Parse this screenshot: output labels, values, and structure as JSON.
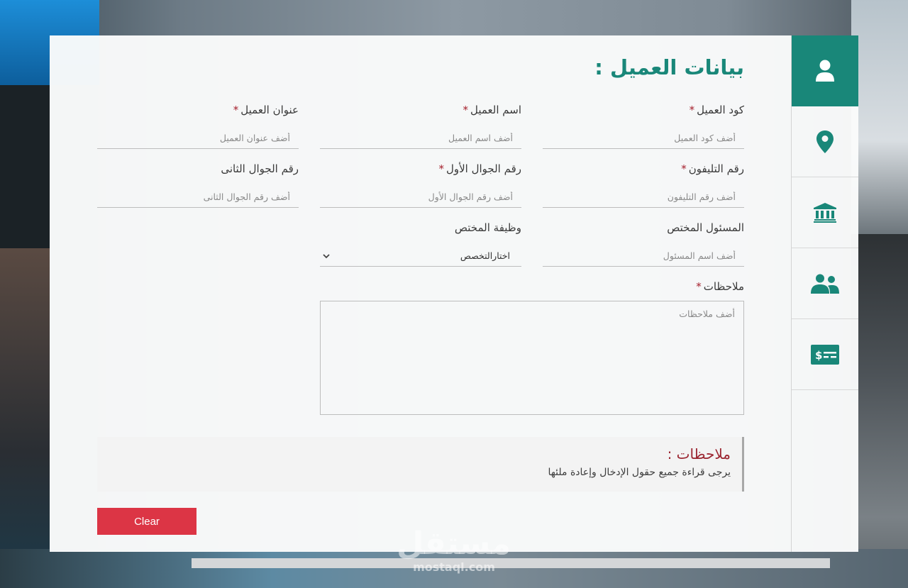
{
  "form": {
    "title": "بيانات العميل :",
    "required_mark": "*",
    "fields": {
      "client_code": {
        "label": "كود العميل",
        "required": true,
        "placeholder": "أضف كود العميل",
        "value": ""
      },
      "client_name": {
        "label": "اسم العميل",
        "required": true,
        "placeholder": "أضف اسم العميل",
        "value": ""
      },
      "client_address": {
        "label": "عنوان العميل",
        "required": true,
        "placeholder": "أضف عنوان العميل",
        "value": ""
      },
      "phone": {
        "label": "رقم التليفون",
        "required": true,
        "placeholder": "أضف رقم التليفون",
        "value": ""
      },
      "mobile1": {
        "label": "رقم الجوال الأول",
        "required": true,
        "placeholder": "أضف رقم الجوال الأول",
        "value": ""
      },
      "mobile2": {
        "label": "رقم الجوال الثانى",
        "required": false,
        "placeholder": "أضف رقم الجوال الثانى",
        "value": ""
      },
      "responsible": {
        "label": "المسئول المختص",
        "required": false,
        "placeholder": "أضف اسم المسئول",
        "value": ""
      },
      "job": {
        "label": "وظيفة المختص",
        "required": false,
        "selected": "اختارالتخصص"
      },
      "notes": {
        "label": "ملاحظات",
        "required": true,
        "placeholder": "أضف ملاحظات",
        "value": ""
      }
    },
    "clear_label": "Clear"
  },
  "notice": {
    "title": "ملاحظات :",
    "text": "يرجى قراءة جميع حقول الإدخال وإعادة ملئها"
  },
  "sidebar": {
    "items": [
      {
        "icon": "user-icon",
        "active": true
      },
      {
        "icon": "map-marker-icon",
        "active": false
      },
      {
        "icon": "bank-icon",
        "active": false
      },
      {
        "icon": "users-icon",
        "active": false
      },
      {
        "icon": "money-check-icon",
        "active": false
      }
    ]
  },
  "theme": {
    "accent": "#198779",
    "danger": "#dc3545",
    "required": "#a51f2c",
    "notice_title": "#9b2530"
  },
  "watermark": {
    "text": "مستقل",
    "sub": "mostaql.com"
  }
}
